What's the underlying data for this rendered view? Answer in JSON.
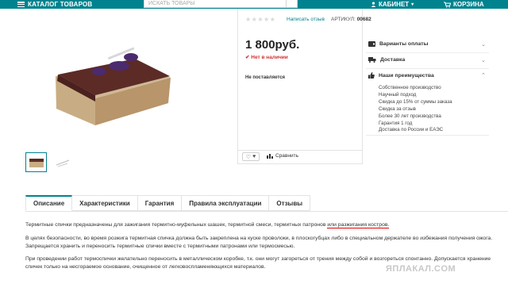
{
  "header": {
    "catalog_label": "КАТАЛОГ ТОВАРОВ",
    "search_placeholder": "ИСКАТЬ ТОВАРЫ",
    "cabinet_label": "КАБИНЕТ",
    "cart_label": "КОРЗИНА",
    "accent_color": "#00838f"
  },
  "product": {
    "review_link": "Написать отзыв",
    "sku_label": "АРТИКУЛ:",
    "sku_value": "00682",
    "price": "1 800руб.",
    "stock_status": "Нет в наличии",
    "delivery_note": "Не поставляется",
    "compare_label": "Сравнить",
    "rating_stars": 0
  },
  "sidebar": {
    "payment_label": "Варианты оплаты",
    "delivery_label": "Доставка",
    "advantages_label": "Наши преимущества",
    "advantages": [
      "Собственное производство",
      "Научный подход",
      "Скидка до 15% от суммы заказа",
      "Скидка за отзыв",
      "Более 30 лет производства",
      "Гарантия 1 год",
      "Доставка по России и ЕАЭС"
    ]
  },
  "tabs": [
    "Описание",
    "Характеристики",
    "Гарантия",
    "Правила эксплуатации",
    "Отзывы"
  ],
  "description": {
    "p1_start": "Термитные спички предназначены для зажигания термитно-муфельных шашек, термитной смеси, термитных патронов ",
    "p1_underlined": "или разжигания костров.",
    "p2": "В целях безопасности, во время розжига термитная спичка должна быть закреплена на куске проволоки, в плоскогубцах либо в специальном держателе во избежания получения ожога. Запрещается хранить и переносить термитные спички вместе с термитными патронами или термосмесью.",
    "p3": "При проведении работ термоспички желательно переносить в металлическом коробке, т.к. они могут загореться от трения между собой и возгореться спонтанно. Допускается хранение спичек только на несгораемое основание, очищенное от легковоспламеняющихся материалов."
  },
  "watermark": "ЯПЛАКАЛ.COM"
}
